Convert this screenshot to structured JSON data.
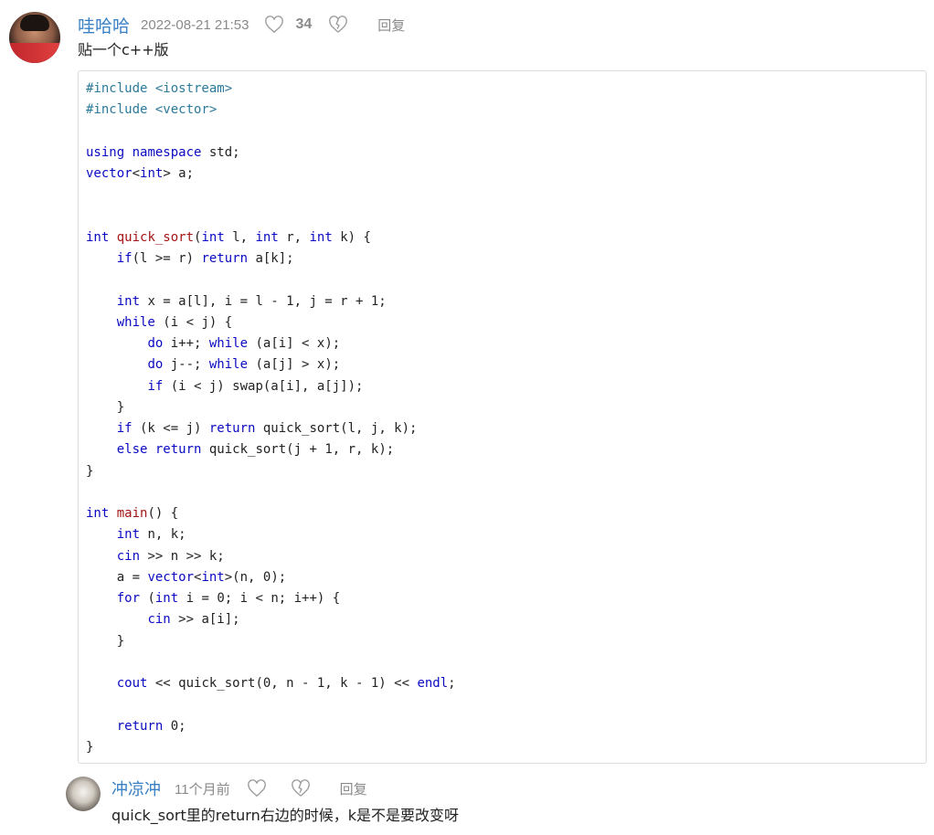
{
  "comment": {
    "username": "哇哈哈",
    "date": "2022-08-21 21:53",
    "likes": "34",
    "reply_label": "回复",
    "text": "贴一个c++版",
    "icons": [
      "heart-icon",
      "broken-heart-icon"
    ],
    "code_lines": [
      [
        [
          "p",
          "#include <iostream>"
        ]
      ],
      [
        [
          "p",
          "#include <vector>"
        ]
      ],
      [],
      [
        [
          "k",
          "using"
        ],
        [
          "t",
          " "
        ],
        [
          "k",
          "namespace"
        ],
        [
          "t",
          " std;"
        ]
      ],
      [
        [
          "k",
          "vector"
        ],
        [
          "t",
          "<"
        ],
        [
          "k",
          "int"
        ],
        [
          "t",
          "> a;"
        ]
      ],
      [],
      [],
      [
        [
          "k",
          "int"
        ],
        [
          "t",
          " "
        ],
        [
          "f",
          "quick_sort"
        ],
        [
          "t",
          "("
        ],
        [
          "k",
          "int"
        ],
        [
          "t",
          " l, "
        ],
        [
          "k",
          "int"
        ],
        [
          "t",
          " r, "
        ],
        [
          "k",
          "int"
        ],
        [
          "t",
          " k) {"
        ]
      ],
      [
        [
          "t",
          "    "
        ],
        [
          "k",
          "if"
        ],
        [
          "t",
          "(l >= r) "
        ],
        [
          "k",
          "return"
        ],
        [
          "t",
          " a[k];"
        ]
      ],
      [],
      [
        [
          "t",
          "    "
        ],
        [
          "k",
          "int"
        ],
        [
          "t",
          " x = a[l], i = l - 1, j = r + 1;"
        ]
      ],
      [
        [
          "t",
          "    "
        ],
        [
          "k",
          "while"
        ],
        [
          "t",
          " (i < j) {"
        ]
      ],
      [
        [
          "t",
          "        "
        ],
        [
          "k",
          "do"
        ],
        [
          "t",
          " i++; "
        ],
        [
          "k",
          "while"
        ],
        [
          "t",
          " (a[i] < x);"
        ]
      ],
      [
        [
          "t",
          "        "
        ],
        [
          "k",
          "do"
        ],
        [
          "t",
          " j--; "
        ],
        [
          "k",
          "while"
        ],
        [
          "t",
          " (a[j] > x);"
        ]
      ],
      [
        [
          "t",
          "        "
        ],
        [
          "k",
          "if"
        ],
        [
          "t",
          " (i < j) swap(a[i], a[j]);"
        ]
      ],
      [
        [
          "t",
          "    }"
        ]
      ],
      [
        [
          "t",
          "    "
        ],
        [
          "k",
          "if"
        ],
        [
          "t",
          " (k <= j) "
        ],
        [
          "k",
          "return"
        ],
        [
          "t",
          " quick_sort(l, j, k);"
        ]
      ],
      [
        [
          "t",
          "    "
        ],
        [
          "k",
          "else"
        ],
        [
          "t",
          " "
        ],
        [
          "k",
          "return"
        ],
        [
          "t",
          " quick_sort(j + 1, r, k);"
        ]
      ],
      [
        [
          "t",
          "}"
        ]
      ],
      [],
      [
        [
          "k",
          "int"
        ],
        [
          "t",
          " "
        ],
        [
          "f",
          "main"
        ],
        [
          "t",
          "() {"
        ]
      ],
      [
        [
          "t",
          "    "
        ],
        [
          "k",
          "int"
        ],
        [
          "t",
          " n, k;"
        ]
      ],
      [
        [
          "t",
          "    "
        ],
        [
          "k",
          "cin"
        ],
        [
          "t",
          " >> n >> k;"
        ]
      ],
      [
        [
          "t",
          "    a = "
        ],
        [
          "k",
          "vector"
        ],
        [
          "t",
          "<"
        ],
        [
          "k",
          "int"
        ],
        [
          "t",
          ">(n, 0);"
        ]
      ],
      [
        [
          "t",
          "    "
        ],
        [
          "k",
          "for"
        ],
        [
          "t",
          " ("
        ],
        [
          "k",
          "int"
        ],
        [
          "t",
          " i = 0; i < n; i++) {"
        ]
      ],
      [
        [
          "t",
          "        "
        ],
        [
          "k",
          "cin"
        ],
        [
          "t",
          " >> a[i];"
        ]
      ],
      [
        [
          "t",
          "    }"
        ]
      ],
      [],
      [
        [
          "t",
          "    "
        ],
        [
          "k",
          "cout"
        ],
        [
          "t",
          " << quick_sort(0, n - 1, k - 1) << "
        ],
        [
          "k",
          "endl"
        ],
        [
          "t",
          ";"
        ]
      ],
      [],
      [
        [
          "t",
          "    "
        ],
        [
          "k",
          "return"
        ],
        [
          "t",
          " 0;"
        ]
      ],
      [
        [
          "t",
          "}"
        ]
      ]
    ]
  },
  "reply": {
    "username": "冲凉冲",
    "date": "11个月前",
    "reply_label": "回复",
    "text": "quick_sort里的return右边的时候，k是不是要改变呀"
  },
  "colors": {
    "username": "#3a80c4",
    "keyword": "#0a0ac2",
    "function": "#a31515",
    "preprocessor": "#2b7a9a",
    "meta_gray": "#8a8a8a"
  }
}
